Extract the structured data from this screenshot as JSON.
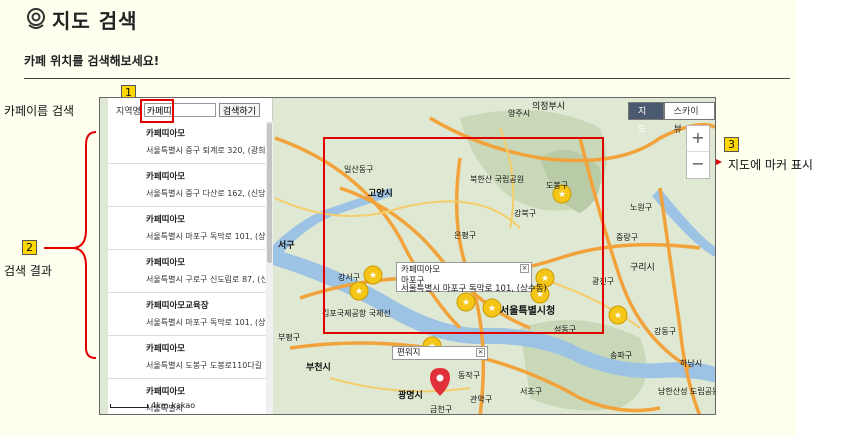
{
  "page": {
    "title": "지도 검색",
    "subtitle": "카페 위치를 검색해보세요!"
  },
  "annotations": {
    "search_label": "카페이름 검색",
    "results_label": "검색 결과",
    "marker_label": "지도에 마커 표시",
    "n1": "1",
    "n2": "2",
    "n3": "3"
  },
  "search": {
    "prefix": "지역명",
    "value": "카페띠",
    "button": "검색하기"
  },
  "results": [
    {
      "name": "카페띠아모",
      "addr": "서울특별시 중구 퇴계로 320, (광희"
    },
    {
      "name": "카페띠아모",
      "addr": "서울특별시 중구 다산로 162, (신당"
    },
    {
      "name": "카페띠아모",
      "addr": "서울특별시 마포구 독막로 101, (상"
    },
    {
      "name": "카페띠아모",
      "addr": "서울특별시 구로구 신도림로 87, (신"
    },
    {
      "name": "카페띠아모교육장",
      "addr": "서울특별시 마포구 독막로 101, (상"
    },
    {
      "name": "카페띠아모",
      "addr": "서울특별시 도봉구 도봉로110다길"
    },
    {
      "name": "카페띠아모",
      "addr": "서울특별시"
    }
  ],
  "map": {
    "type_map": "지도",
    "type_skyview": "스카이뷰",
    "zoom_in": "+",
    "zoom_out": "−",
    "scale": "4km",
    "brand": "kakao",
    "places": [
      "의정부시",
      "고양시",
      "양주시",
      "일산동구",
      "북한산 국립공원",
      "도봉구",
      "강북구",
      "은평구",
      "광진구",
      "구리시",
      "부천시",
      "광명시",
      "관악구",
      "동작구",
      "강동구",
      "송파구",
      "하남시",
      "서울특별시청",
      "김포국제공항 국제선",
      "남한산성 도립공원",
      "노원구",
      "강서구",
      "성동구",
      "서구",
      "부평구",
      "중랑구",
      "금천구",
      "서초구"
    ],
    "info_main": {
      "name": "카페띠아모",
      "district": "마포구",
      "addr": "서울특별시 마포구 독막로 101, (상수동)"
    },
    "info_small": "편워지",
    "info_close": "×"
  },
  "colors": {
    "annotation_box": "#e00000",
    "marker_star": "#f5c518",
    "marker_pin": "#e0303a",
    "road": "#f2a23a"
  }
}
